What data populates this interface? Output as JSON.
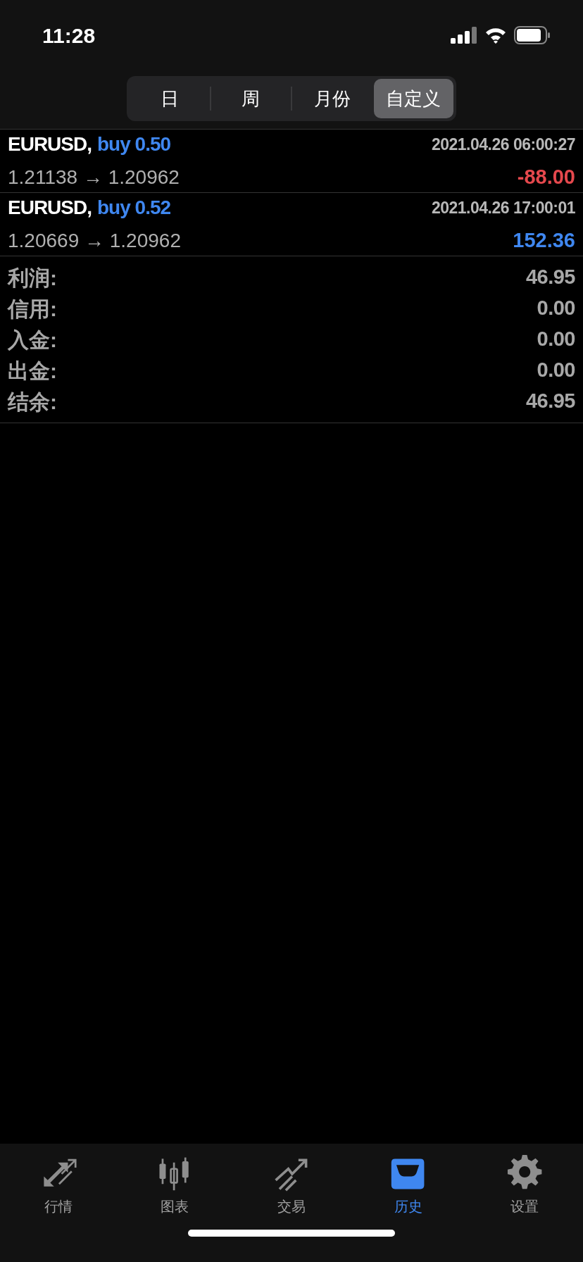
{
  "status_bar": {
    "time": "11:28"
  },
  "period_tabs": [
    {
      "label": "日",
      "selected": false
    },
    {
      "label": "周",
      "selected": false
    },
    {
      "label": "月份",
      "selected": false
    },
    {
      "label": "自定义",
      "selected": true
    }
  ],
  "deals": [
    {
      "symbol": "EURUSD,",
      "side": "buy 0.50",
      "time": "2021.04.26 06:00:27",
      "prices": "1.21138 → 1.20962",
      "profit": "-88.00",
      "kind": "loss"
    },
    {
      "symbol": "EURUSD,",
      "side": "buy 0.52",
      "time": "2021.04.26 17:00:01",
      "prices": "1.20669 → 1.20962",
      "profit": "152.36",
      "kind": "gain"
    }
  ],
  "summary": [
    {
      "label": "利润:",
      "value": "46.95"
    },
    {
      "label": "信用:",
      "value": "0.00"
    },
    {
      "label": "入金:",
      "value": "0.00"
    },
    {
      "label": "出金:",
      "value": "0.00"
    },
    {
      "label": "结余:",
      "value": "46.95"
    }
  ],
  "tab_bar": [
    {
      "label": "行情",
      "kind": "quotes",
      "selected": false
    },
    {
      "label": "图表",
      "kind": "chart",
      "selected": false
    },
    {
      "label": "交易",
      "kind": "trade",
      "selected": false
    },
    {
      "label": "历史",
      "kind": "history",
      "selected": true
    },
    {
      "label": "设置",
      "kind": "settings",
      "selected": false
    }
  ]
}
